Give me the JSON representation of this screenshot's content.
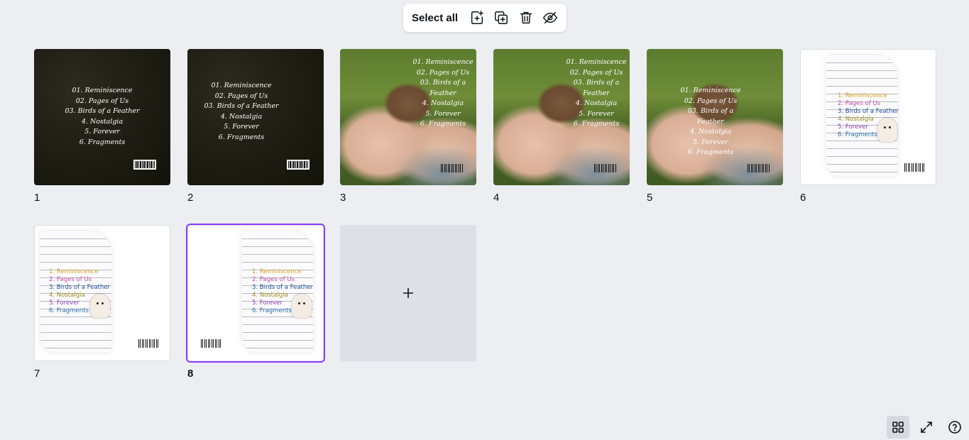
{
  "toolbar": {
    "select_all_label": "Select all",
    "icons": [
      "add-page-icon",
      "duplicate-page-icon",
      "delete-icon",
      "hide-icon"
    ]
  },
  "track_list_cover": [
    "01. Reminiscence",
    "02. Pages of Us",
    "03. Birds of a Feather",
    "4. Nostalgia",
    "5. Forever",
    "6. Fragments"
  ],
  "track_list_notebook": [
    "1. Reminiscence",
    "2. Pages of Us",
    "3. Birds of a Feather",
    "4. Nostalgia",
    "5. Forever",
    "6. Fragments"
  ],
  "pages": [
    {
      "number": "1",
      "style": "dark",
      "selected": false
    },
    {
      "number": "2",
      "style": "dark",
      "selected": false
    },
    {
      "number": "3",
      "style": "bird",
      "selected": false
    },
    {
      "number": "4",
      "style": "bird",
      "selected": false
    },
    {
      "number": "5",
      "style": "bird",
      "selected": false
    },
    {
      "number": "6",
      "style": "notebook",
      "selected": false
    },
    {
      "number": "7",
      "style": "notebook",
      "selected": false
    },
    {
      "number": "8",
      "style": "notebook",
      "selected": true
    }
  ],
  "add_page": {
    "icon": "plus-icon"
  },
  "bottom_tools": {
    "icons": [
      "grid-view-icon",
      "fullscreen-icon",
      "help-icon"
    ],
    "active": "grid-view-icon"
  },
  "colors": {
    "selection_outline": "#8b3dff",
    "background": "#eceef2",
    "add_page_bg": "#dde0e6"
  }
}
